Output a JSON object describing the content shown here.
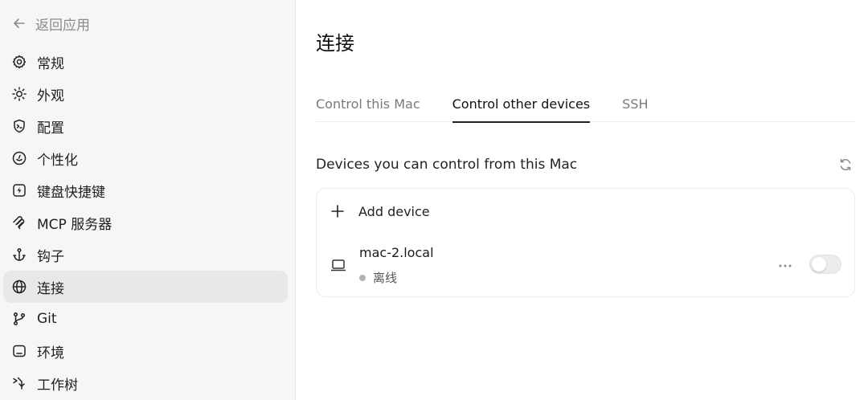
{
  "sidebar": {
    "back_label": "返回应用",
    "items": [
      {
        "label": "常规",
        "icon": "gear-icon"
      },
      {
        "label": "外观",
        "icon": "sun-icon"
      },
      {
        "label": "配置",
        "icon": "shield-terminal-icon"
      },
      {
        "label": "个性化",
        "icon": "smile-icon"
      },
      {
        "label": "键盘快捷键",
        "icon": "lightning-key-icon"
      },
      {
        "label": "MCP 服务器",
        "icon": "mcp-icon"
      },
      {
        "label": "钩子",
        "icon": "anchor-icon"
      },
      {
        "label": "连接",
        "icon": "globe-icon",
        "active": true
      },
      {
        "label": "Git",
        "icon": "git-branch-icon"
      },
      {
        "label": "环境",
        "icon": "terminal-window-icon"
      },
      {
        "label": "工作树",
        "icon": "worktree-icon"
      }
    ]
  },
  "main": {
    "title": "连接",
    "tabs": [
      {
        "label": "Control this Mac",
        "active": false
      },
      {
        "label": "Control other devices",
        "active": true
      },
      {
        "label": "SSH",
        "active": false
      }
    ],
    "section_title": "Devices you can control from this Mac",
    "add_device_label": "Add device",
    "device": {
      "name": "mac-2.local",
      "status": "离线",
      "status_color": "#b3b3b3",
      "enabled": false
    }
  },
  "colors": {
    "sidebar_bg": "#f6f6f6",
    "active_item_bg": "#e8e8e8",
    "accent_text": "#111111"
  }
}
